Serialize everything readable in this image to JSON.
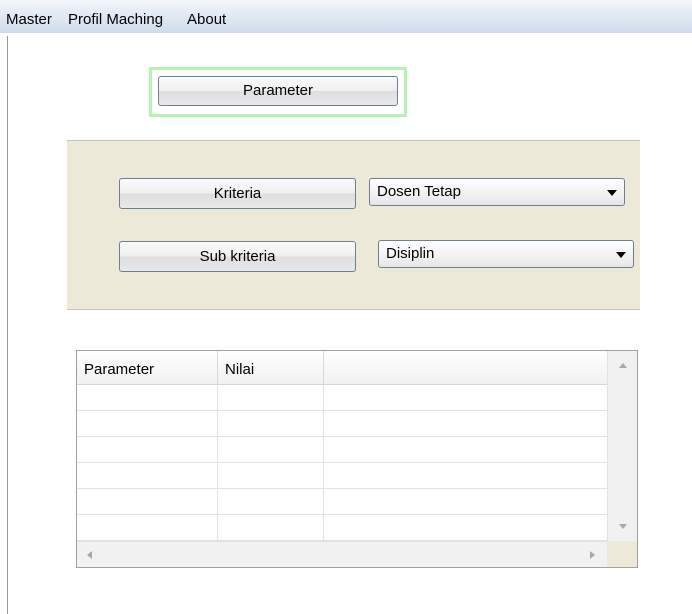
{
  "menu": {
    "items": [
      "Master",
      "Profil Maching",
      "About"
    ]
  },
  "parameter_button": "Parameter",
  "panel": {
    "kriteria_button": "Kriteria",
    "sub_kriteria_button": "Sub kriteria",
    "kriteria_combo_value": "Dosen Tetap",
    "sub_kriteria_combo_value": "Disiplin"
  },
  "grid": {
    "columns": [
      "Parameter",
      "Nilai",
      ""
    ],
    "rows": [
      [
        "",
        "",
        ""
      ],
      [
        "",
        "",
        ""
      ],
      [
        "",
        "",
        ""
      ],
      [
        "",
        "",
        ""
      ],
      [
        "",
        "",
        ""
      ],
      [
        "",
        "",
        ""
      ]
    ]
  }
}
